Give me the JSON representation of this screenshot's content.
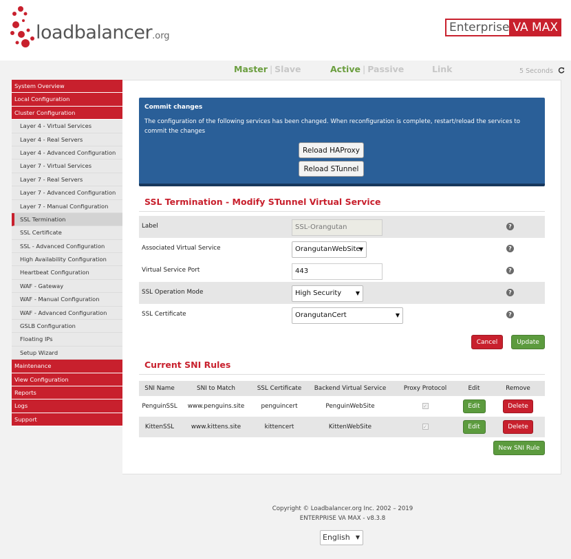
{
  "header": {
    "logo_text": "loadbalancer",
    "logo_suffix": ".org",
    "edition_left": "Enterprise",
    "edition_right": "VA MAX",
    "brand_color": "#c8202d"
  },
  "status": {
    "master": "Master",
    "slave": "Slave",
    "active": "Active",
    "passive": "Passive",
    "link": "Link",
    "separator": "|",
    "refresh_text": "5 Seconds",
    "refresh_icon": "refresh-icon"
  },
  "sidebar": {
    "items": [
      {
        "label": "System Overview"
      },
      {
        "label": "Local Configuration"
      },
      {
        "label": "Cluster Configuration"
      },
      {
        "label": "Layer 4 - Virtual Services"
      },
      {
        "label": "Layer 4 - Real Servers"
      },
      {
        "label": "Layer 4 - Advanced Configuration"
      },
      {
        "label": "Layer 7 - Virtual Services"
      },
      {
        "label": "Layer 7 - Real Servers"
      },
      {
        "label": "Layer 7 - Advanced Configuration"
      },
      {
        "label": "Layer 7 - Manual Configuration"
      },
      {
        "label": "SSL Termination"
      },
      {
        "label": "SSL Certificate"
      },
      {
        "label": "SSL - Advanced Configuration"
      },
      {
        "label": "High Availability Configuration"
      },
      {
        "label": "Heartbeat Configuration"
      },
      {
        "label": "WAF - Gateway"
      },
      {
        "label": "WAF - Manual Configuration"
      },
      {
        "label": "WAF - Advanced Configuration"
      },
      {
        "label": "GSLB Configuration"
      },
      {
        "label": "Floating IPs"
      },
      {
        "label": "Setup Wizard"
      },
      {
        "label": "Maintenance"
      },
      {
        "label": "View Configuration"
      },
      {
        "label": "Reports"
      },
      {
        "label": "Logs"
      },
      {
        "label": "Support"
      }
    ]
  },
  "commit": {
    "title": "Commit changes",
    "text": "The configuration of the following services has been changed. When reconfiguration is complete, restart/reload the services to commit the changes",
    "reload_haproxy": "Reload HAProxy",
    "reload_stunnel": "Reload STunnel"
  },
  "ssl_form": {
    "title": "SSL Termination - Modify STunnel Virtual Service",
    "label_label": "Label",
    "label_value": "SSL-Orangutan",
    "assoc_label": "Associated Virtual Service",
    "assoc_value": "OrangutanWebSite",
    "port_label": "Virtual Service Port",
    "port_value": "443",
    "mode_label": "SSL Operation Mode",
    "mode_value": "High Security",
    "cert_label": "SSL Certificate",
    "cert_value": "OrangutanCert",
    "help": "?",
    "arrow": "▼",
    "cancel": "Cancel",
    "update": "Update"
  },
  "sni": {
    "title": "Current SNI Rules",
    "headers": [
      "SNI Name",
      "SNI to Match",
      "SSL Certificate",
      "Backend Virtual Service",
      "Proxy Protocol",
      "Edit",
      "Remove"
    ],
    "rows": [
      {
        "name": "PenguinSSL",
        "match": "www.penguins.site",
        "cert": "penguincert",
        "backend": "PenguinWebSite",
        "proxy_checked": true,
        "edit": "Edit",
        "remove": "Delete"
      },
      {
        "name": "KittenSSL",
        "match": "www.kittens.site",
        "cert": "kittencert",
        "backend": "KittenWebSite",
        "proxy_checked": true,
        "edit": "Edit",
        "remove": "Delete"
      }
    ],
    "check_mark": "✓",
    "new_rule": "New SNI Rule"
  },
  "footer": {
    "copyright": "Copyright © Loadbalancer.org Inc. 2002 – 2019",
    "version": "ENTERPRISE VA MAX - v8.3.8",
    "language": "English"
  }
}
